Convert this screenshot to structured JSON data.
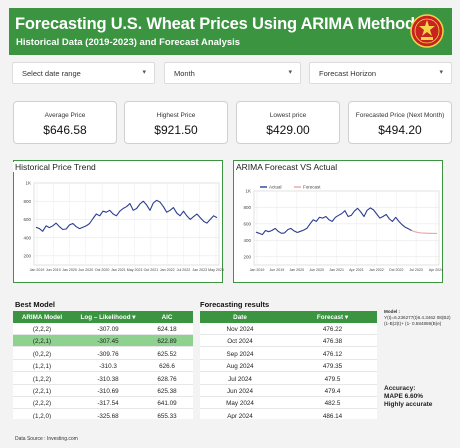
{
  "header": {
    "title": "Forecasting U.S. Wheat Prices Using ARIMA Method",
    "subtitle": "Historical Data (2019-2023) and Forecast Analysis",
    "logo_icon": "seal-emblem-icon",
    "brand_color": "#3a9440"
  },
  "filters": [
    {
      "label": "Select date range"
    },
    {
      "label": "Month"
    },
    {
      "label": "Forecast Horizon"
    }
  ],
  "kpis": [
    {
      "label": "Average Price",
      "value": "$646.58"
    },
    {
      "label": "Highest Price",
      "value": "$921.50"
    },
    {
      "label": "Lowest price",
      "value": "$429.00"
    },
    {
      "label": "Forecasted Price (Next Month)",
      "value": "$494.20"
    }
  ],
  "chart_data": [
    {
      "type": "line",
      "title": "Historical Price Trend",
      "y_ticks": [
        "1K",
        "800",
        "600",
        "400",
        "200"
      ],
      "ylim": [
        100,
        1000
      ],
      "x_ticks": [
        "Jan 2019",
        "Jun 2019",
        "Jan 2020",
        "Jun 2020",
        "Oct 2020",
        "Jan 2021",
        "May 2021",
        "Oct 2021",
        "Jan 2022",
        "Jul 2022",
        "Jan 2023",
        "May 2023"
      ],
      "grid": true,
      "series": [
        {
          "color": "#2c3e8f",
          "values": [
            515,
            500,
            470,
            530,
            510,
            530,
            560,
            520,
            490,
            495,
            540,
            555,
            520,
            500,
            515,
            530,
            555,
            610,
            660,
            640,
            690,
            680,
            700,
            660,
            640,
            690,
            720,
            740,
            775,
            700,
            720,
            770,
            800,
            760,
            700,
            780,
            810,
            790,
            740,
            680,
            700,
            730,
            670,
            640,
            690,
            640,
            600,
            630,
            660,
            620,
            580,
            560,
            600,
            640,
            620
          ]
        }
      ]
    },
    {
      "type": "line",
      "title": "ARIMA Forecast VS Actual",
      "legend": [
        "Actual",
        "Forecast"
      ],
      "legend_position": "top-left",
      "y_ticks": [
        "1K",
        "800",
        "600",
        "400",
        "200"
      ],
      "ylim": [
        100,
        1000
      ],
      "x_ticks": [
        "Jan 2019",
        "Jun 2019",
        "Jan 2020",
        "Jun 2020",
        "Jan 2021",
        "Apr 2021",
        "Jan 2022",
        "Oct 2022",
        "Jul 2023",
        "Apr 2024"
      ],
      "grid": true,
      "series": [
        {
          "name": "Actual",
          "color": "#2c3e8f",
          "values": [
            500,
            485,
            470,
            520,
            505,
            520,
            545,
            510,
            485,
            490,
            530,
            545,
            515,
            495,
            510,
            525,
            545,
            600,
            650,
            630,
            680,
            670,
            690,
            650,
            630,
            680,
            705,
            725,
            760,
            690,
            705,
            755,
            790,
            745,
            690,
            765,
            795,
            770,
            720,
            670,
            690,
            715,
            660,
            630,
            680,
            630,
            590,
            560,
            540,
            520
          ]
        },
        {
          "name": "Forecast",
          "color": "#e8a5a5",
          "values": [
            520,
            505,
            495,
            490,
            488,
            486,
            485,
            484,
            484
          ]
        }
      ]
    }
  ],
  "best_model": {
    "title": "Best Model",
    "columns": [
      "ARIMA Model",
      "Log – Likelihood",
      "AIC"
    ],
    "highlight_color": "#8fd18f",
    "rows": [
      [
        "(2,2,2)",
        "-307.09",
        "624.18"
      ],
      [
        "(2,2,1)",
        "-307.45",
        "622.89"
      ],
      [
        "(0,2,2)",
        "-309.76",
        "625.52"
      ],
      [
        "(1,2,1)",
        "-310.3",
        "626.6"
      ],
      [
        "(1,2,2)",
        "-310.38",
        "628.76"
      ],
      [
        "(2,2,1)",
        "-310.69",
        "625.38"
      ],
      [
        "(2,2,2)",
        "-317.54",
        "641.09"
      ],
      [
        "(1,2,0)",
        "-325.68",
        "655.33"
      ]
    ]
  },
  "forecasting": {
    "title": "Forecasting results",
    "columns": [
      "Date",
      "Forecast"
    ],
    "rows": [
      [
        "Nov 2024",
        "476.22"
      ],
      [
        "Oct 2024",
        "476.38"
      ],
      [
        "Sep 2024",
        "476.12"
      ],
      [
        "Aug 2024",
        "479.35"
      ],
      [
        "Jul 2024",
        "479.5"
      ],
      [
        "Jun 2024",
        "479.4"
      ],
      [
        "May 2024",
        "482.5"
      ],
      [
        "Apr 2024",
        "486.14"
      ]
    ]
  },
  "model_info": {
    "label": "Model :",
    "equation": "Y(t)=6.236277(t)6.4.3462 08(B2) (1-B)2(t)+ (1- 0.584859(B)e)",
    "accuracy_label": "Accuracy:",
    "mape": "MAPE 6.60%",
    "verdict": "Highly accurate"
  },
  "footer": {
    "source": "Data Source : Investing.com"
  }
}
